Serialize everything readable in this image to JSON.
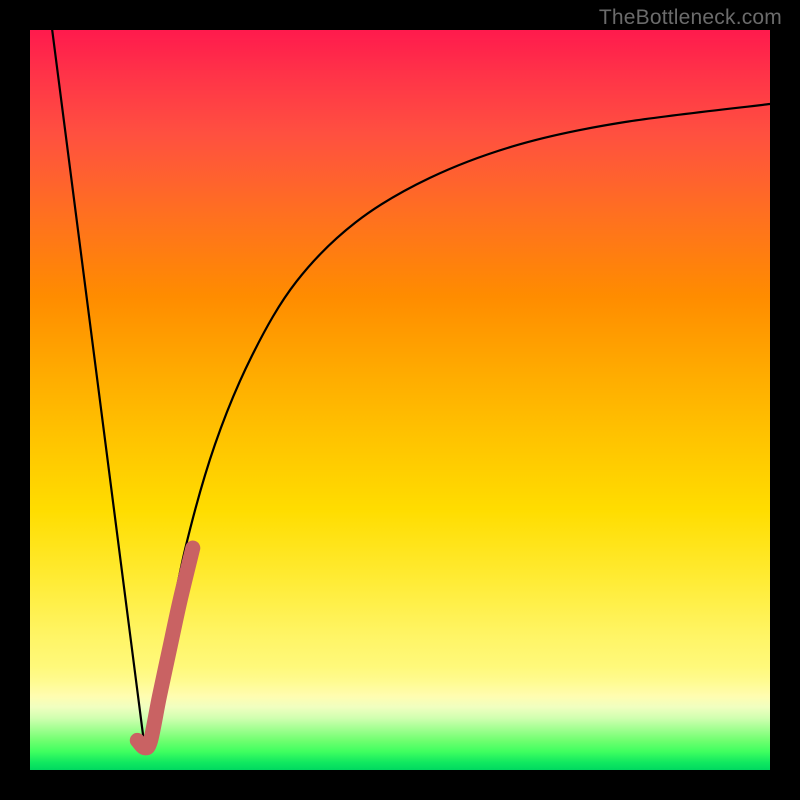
{
  "watermark": "TheBottleneck.com",
  "colors": {
    "frame": "#000000",
    "curve": "#000000",
    "highlight": "#c96263",
    "gradient_top": "#ff1a4d",
    "gradient_mid": "#ffdd00",
    "gradient_bottom": "#00d860"
  },
  "chart_data": {
    "type": "line",
    "title": "",
    "xlabel": "",
    "ylabel": "",
    "xlim": [
      0,
      100
    ],
    "ylim": [
      0,
      100
    ],
    "legend": false,
    "grid": false,
    "series": [
      {
        "name": "left-linear-drop",
        "x": [
          3,
          15.5
        ],
        "values": [
          100,
          3
        ]
      },
      {
        "name": "right-asymptote",
        "x": [
          15.5,
          18,
          21,
          25,
          30,
          36,
          44,
          54,
          66,
          80,
          100
        ],
        "values": [
          3,
          15,
          30,
          44,
          56,
          66,
          74,
          80,
          84.5,
          87.5,
          90
        ]
      },
      {
        "name": "highlight-segment",
        "x": [
          14.5,
          15.5,
          16.3,
          17.5,
          19,
          20.3,
          22
        ],
        "values": [
          4,
          3,
          4,
          10,
          17,
          23,
          30
        ]
      }
    ],
    "annotations": []
  }
}
